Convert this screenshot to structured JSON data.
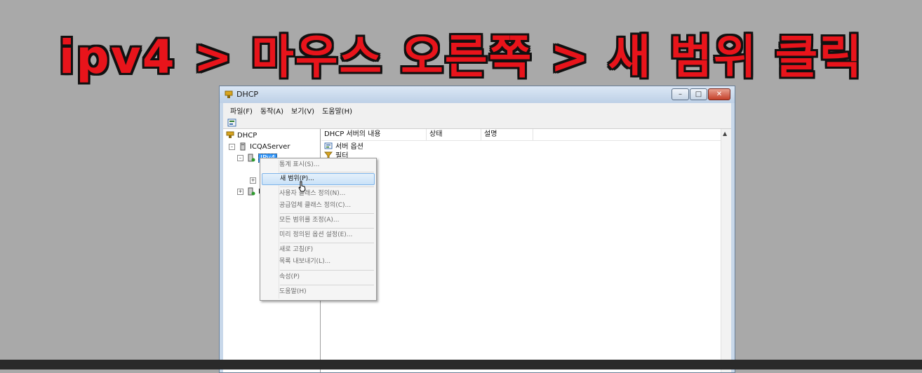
{
  "banner": {
    "text": "ipv4 > 마우스 오른쪽 > 새 범위 클릭"
  },
  "window": {
    "title": "DHCP",
    "controls": {
      "minimize": "–",
      "maximize": "□",
      "close": "✕"
    }
  },
  "menubar": [
    "파일(F)",
    "동작(A)",
    "보기(V)",
    "도움말(H)"
  ],
  "tree": {
    "root": "DHCP",
    "server": "ICQAServer",
    "ipv4": "IPv4",
    "ipv6_prefix": "I"
  },
  "list": {
    "columns": [
      "DHCP 서버의 내용",
      "상태",
      "설명"
    ],
    "rows": [
      "서버 옵션",
      "필터"
    ]
  },
  "context_menu": {
    "items": [
      {
        "label": "통계 표시(S)...",
        "enabled": false
      },
      {
        "label": "새 범위(P)...",
        "enabled": true,
        "highlighted": true
      },
      {
        "label": "사용자 클래스 정의(N)...",
        "enabled": false
      },
      {
        "label": "공급업체 클래스 정의(C)...",
        "enabled": false
      },
      {
        "label": "모든 범위를 조정(A)...",
        "enabled": false
      },
      {
        "label": "미리 정의된 옵션 설정(E)...",
        "enabled": false
      },
      {
        "label": "새로 고침(F)",
        "enabled": false
      },
      {
        "label": "목록 내보내기(L)...",
        "enabled": false
      },
      {
        "label": "속성(P)",
        "enabled": false
      },
      {
        "label": "도움말(H)",
        "enabled": false
      }
    ]
  },
  "colors": {
    "banner_red": "#e8141b",
    "selection_blue": "#3399ff",
    "menu_highlight": "#c9e2f8"
  }
}
